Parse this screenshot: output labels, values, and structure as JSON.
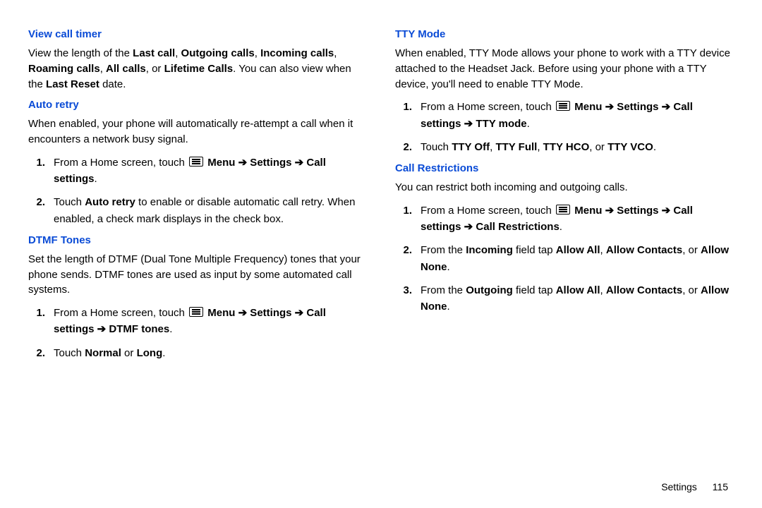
{
  "left": {
    "h1": "View call timer",
    "p1_a": "View the length of the ",
    "p1_b1": "Last call",
    "p1_c1": ", ",
    "p1_b2": "Outgoing calls",
    "p1_c2": ", ",
    "p1_b3": "Incoming calls",
    "p1_c3": ", ",
    "p1_b4": "Roaming calls",
    "p1_c4": ", ",
    "p1_b5": "All calls",
    "p1_c5": ", or ",
    "p1_b6": "Lifetime Calls",
    "p1_c6": ". You can also view when the ",
    "p1_b7": "Last Reset",
    "p1_c7": " date.",
    "h2": "Auto retry",
    "p2": "When enabled, your phone will automatically re-attempt a call when it encounters a network busy signal.",
    "s1_num": "1.",
    "s1_a": "From a Home screen, touch ",
    "s1_b": " Menu ➔ Settings ➔ Call settings",
    "s1_c": ".",
    "s2_num": "2.",
    "s2_a": "Touch ",
    "s2_b": "Auto retry",
    "s2_c": " to enable or disable automatic call retry. When enabled, a check mark displays in the check box.",
    "h3": "DTMF Tones",
    "p3": "Set the length of DTMF (Dual Tone Multiple Frequency) tones that your phone sends. DTMF tones are used as input by some automated call systems.",
    "s3_num": "1.",
    "s3_a": "From a Home screen, touch ",
    "s3_b": " Menu ➔ Settings ➔ Call settings ➔ DTMF tones",
    "s3_c": ".",
    "s4_num": "2.",
    "s4_a": "Touch ",
    "s4_b1": "Normal",
    "s4_m": " or ",
    "s4_b2": "Long",
    "s4_c": "."
  },
  "right": {
    "h1": "TTY Mode",
    "p1": "When enabled, TTY Mode allows your phone to work with a TTY device attached to the Headset Jack. Before using your phone with a TTY device, you'll need to enable TTY Mode.",
    "s1_num": "1.",
    "s1_a": "From a Home screen, touch ",
    "s1_b": " Menu ➔ Settings ➔ Call settings ➔ TTY mode",
    "s1_c": ".",
    "s2_num": "2.",
    "s2_a": "Touch ",
    "s2_b1": "TTY Off",
    "s2_m1": ", ",
    "s2_b2": "TTY Full",
    "s2_m2": ", ",
    "s2_b3": "TTY HCO",
    "s2_m3": ", or ",
    "s2_b4": "TTY VCO",
    "s2_c": ".",
    "h2": "Call Restrictions",
    "p2": "You can restrict both incoming and outgoing calls.",
    "s3_num": "1.",
    "s3_a": "From a Home screen, touch ",
    "s3_b": " Menu ➔ Settings ➔ Call settings ➔ Call Restrictions",
    "s3_c": ".",
    "s4_num": "2.",
    "s4_a": "From the ",
    "s4_b0": "Incoming",
    "s4_m0": " field tap ",
    "s4_b1": "Allow All",
    "s4_m1": ", ",
    "s4_b2": "Allow Contacts",
    "s4_m2": ", or ",
    "s4_b3": "Allow None",
    "s4_c": ".",
    "s5_num": "3.",
    "s5_a": "From the ",
    "s5_b0": "Outgoing",
    "s5_m0": " field tap ",
    "s5_b1": "Allow All",
    "s5_m1": ", ",
    "s5_b2": "Allow Contacts",
    "s5_m2": ", or ",
    "s5_b3": "Allow None",
    "s5_c": "."
  },
  "footer": {
    "section": "Settings",
    "page": "115"
  }
}
